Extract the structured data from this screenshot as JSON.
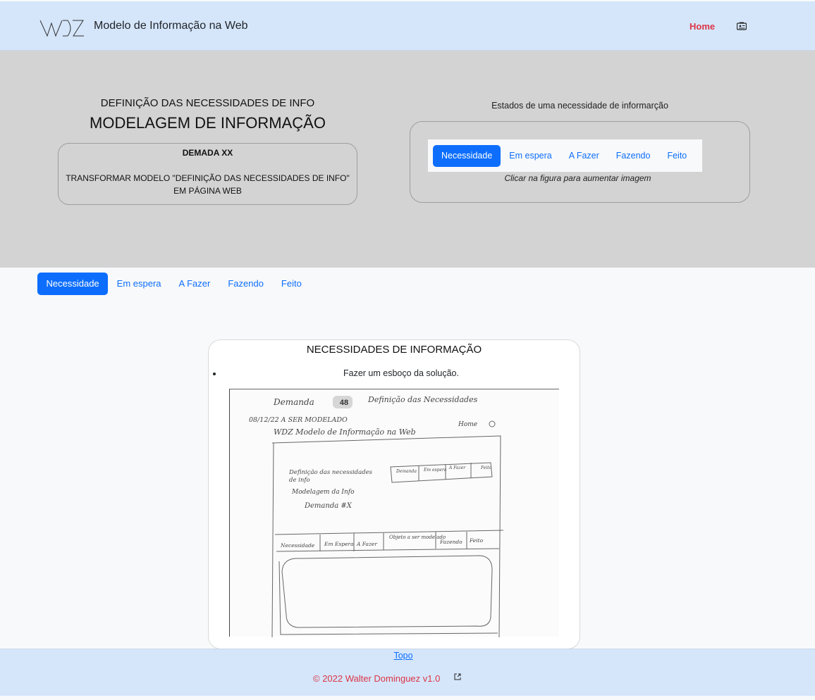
{
  "navbar": {
    "brand": "Modelo de Informação na Web",
    "home": "Home",
    "logo_icon": "wdz-logo",
    "extra_icon": "id-card-icon",
    "home_color": "#dc3545"
  },
  "hero": {
    "subtitle": "DEFINIÇÃO DAS NECESSIDADES DE INFO",
    "title": "MODELAGEM DE INFORMAÇÃO",
    "demand_title": "DEMADA XX",
    "demand_text": "TRANSFORMAR MODELO \"DEFINIÇÃO DAS NECESSIDADES DE INFO\" EM PÁGINA WEB",
    "states_label": "Estados de uma necessidade de informarção",
    "states": [
      "Necessidade",
      "Em espera",
      "A Fazer",
      "Fazendo",
      "Feito"
    ],
    "caption": "Clicar na figura para aumentar imagem"
  },
  "tabs": {
    "items": [
      "Necessidade",
      "Em espera",
      "A Fazer",
      "Fazendo",
      "Feito"
    ],
    "active": "Necessidade",
    "accent": "#0d6efd"
  },
  "content": {
    "title": "NECESSIDADES DE INFORMAÇÃO",
    "items": [
      "Fazer um esboço da solução."
    ]
  },
  "sketch": {
    "demand_label": "Demanda",
    "demand_number": "48",
    "header_note": "Definição das Necessidades",
    "date_note": "08/12/22 A SER MODELADO",
    "brand": "WDZ Modelo de Informação na Web",
    "home": "Home",
    "line1": "Definição das necessidades",
    "line2": "de info",
    "line3": "Modelagem da Info",
    "demand_xx": "Demanda #X",
    "mini_states": [
      "Demanda",
      "Em espera",
      "A Fazer",
      "Feito"
    ],
    "tabs": [
      "Necessidade",
      "Em Espera",
      "A Fazer",
      "Objeto a ser modelado",
      "Fazendo",
      "Feito"
    ]
  },
  "footer": {
    "topo": "Topo",
    "copyright": "© 2022 Walter Dominguez v1.0",
    "ext_icon": "external-link-icon",
    "copyright_color": "#dc3545"
  }
}
